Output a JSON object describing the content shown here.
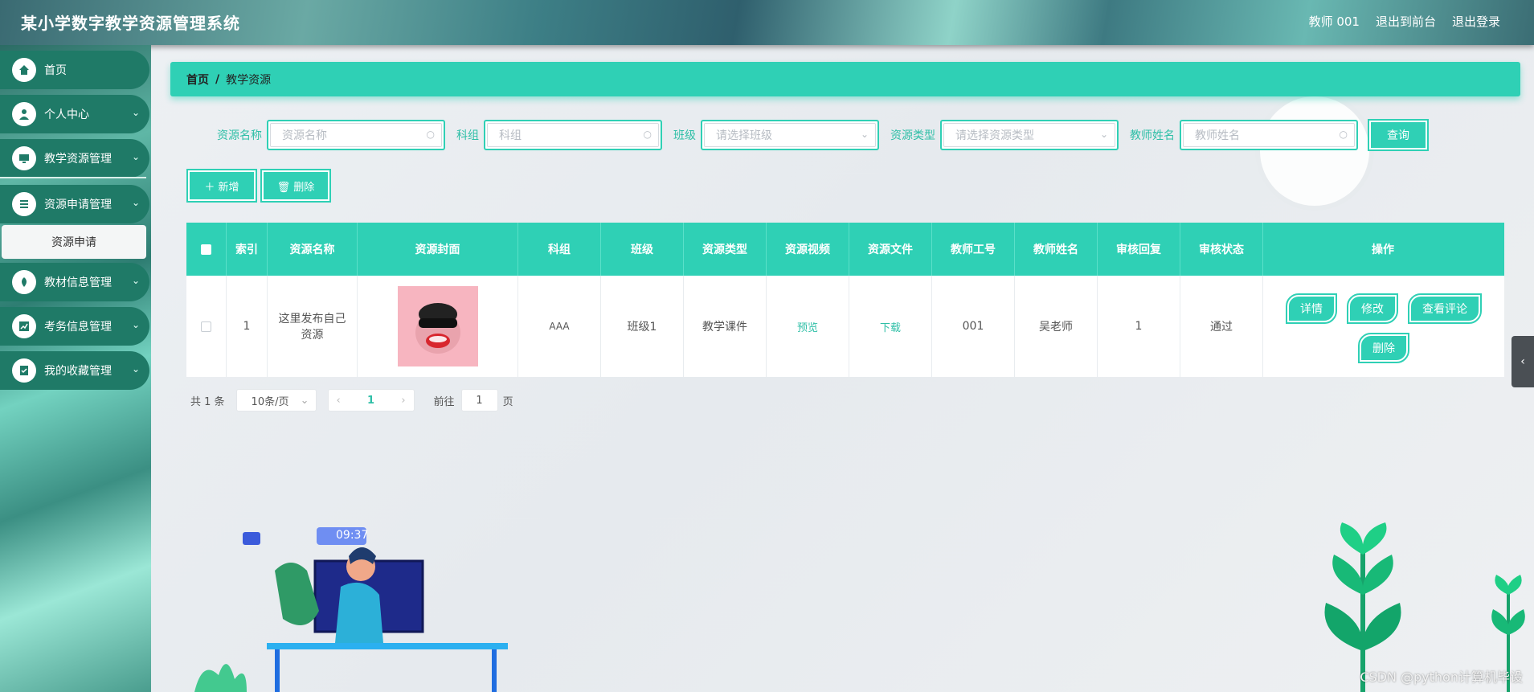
{
  "app": {
    "title": "某小学数字教学资源管理系统"
  },
  "header": {
    "user": "教师 001",
    "front_link": "退出到前台",
    "logout": "退出登录"
  },
  "sidebar": {
    "items": [
      {
        "label": "首页",
        "icon": "home-icon"
      },
      {
        "label": "个人中心",
        "icon": "user-icon"
      },
      {
        "label": "教学资源管理",
        "icon": "monitor-icon"
      },
      {
        "label": "资源申请管理",
        "icon": "list-icon"
      },
      {
        "label": "教材信息管理",
        "icon": "leaf-icon"
      },
      {
        "label": "考务信息管理",
        "icon": "chart-icon"
      },
      {
        "label": "我的收藏管理",
        "icon": "clipboard-check-icon"
      }
    ],
    "subitem": "资源申请"
  },
  "breadcrumb": {
    "home": "首页",
    "sep": "/",
    "current": "教学资源"
  },
  "search": {
    "name_label": "资源名称",
    "name_placeholder": "资源名称",
    "group_label": "科组",
    "group_placeholder": "科组",
    "class_label": "班级",
    "class_placeholder": "请选择班级",
    "type_label": "资源类型",
    "type_placeholder": "请选择资源类型",
    "teacher_label": "教师姓名",
    "teacher_placeholder": "教师姓名",
    "query": "查询"
  },
  "actions": {
    "add": "＋ 新增",
    "delete": "🗑 删除"
  },
  "table": {
    "headers": [
      "",
      "索引",
      "资源名称",
      "资源封面",
      "科组",
      "班级",
      "资源类型",
      "资源视频",
      "资源文件",
      "教师工号",
      "教师姓名",
      "审核回复",
      "审核状态",
      "操作"
    ],
    "rows": [
      {
        "index": "1",
        "name": "这里发布自己资源",
        "group": "AAA",
        "class": "班级1",
        "type": "教学课件",
        "video": "预览",
        "file": "下载",
        "teacher_id": "001",
        "teacher_name": "吴老师",
        "reply": "1",
        "status": "通过"
      }
    ],
    "ops": {
      "detail": "详情",
      "edit": "修改",
      "comments": "查看评论",
      "delete": "删除"
    }
  },
  "pagination": {
    "total": "共 1 条",
    "page_size": "10条/页",
    "current": "1",
    "goto_label": "前往",
    "goto_value": "1",
    "page_unit": "页"
  },
  "illustration": {
    "clock": "09:37"
  },
  "watermark": "CSDN @python计算机毕设",
  "colors": {
    "accent": "#2fd0b5",
    "sidebar": "#1f7a67"
  }
}
